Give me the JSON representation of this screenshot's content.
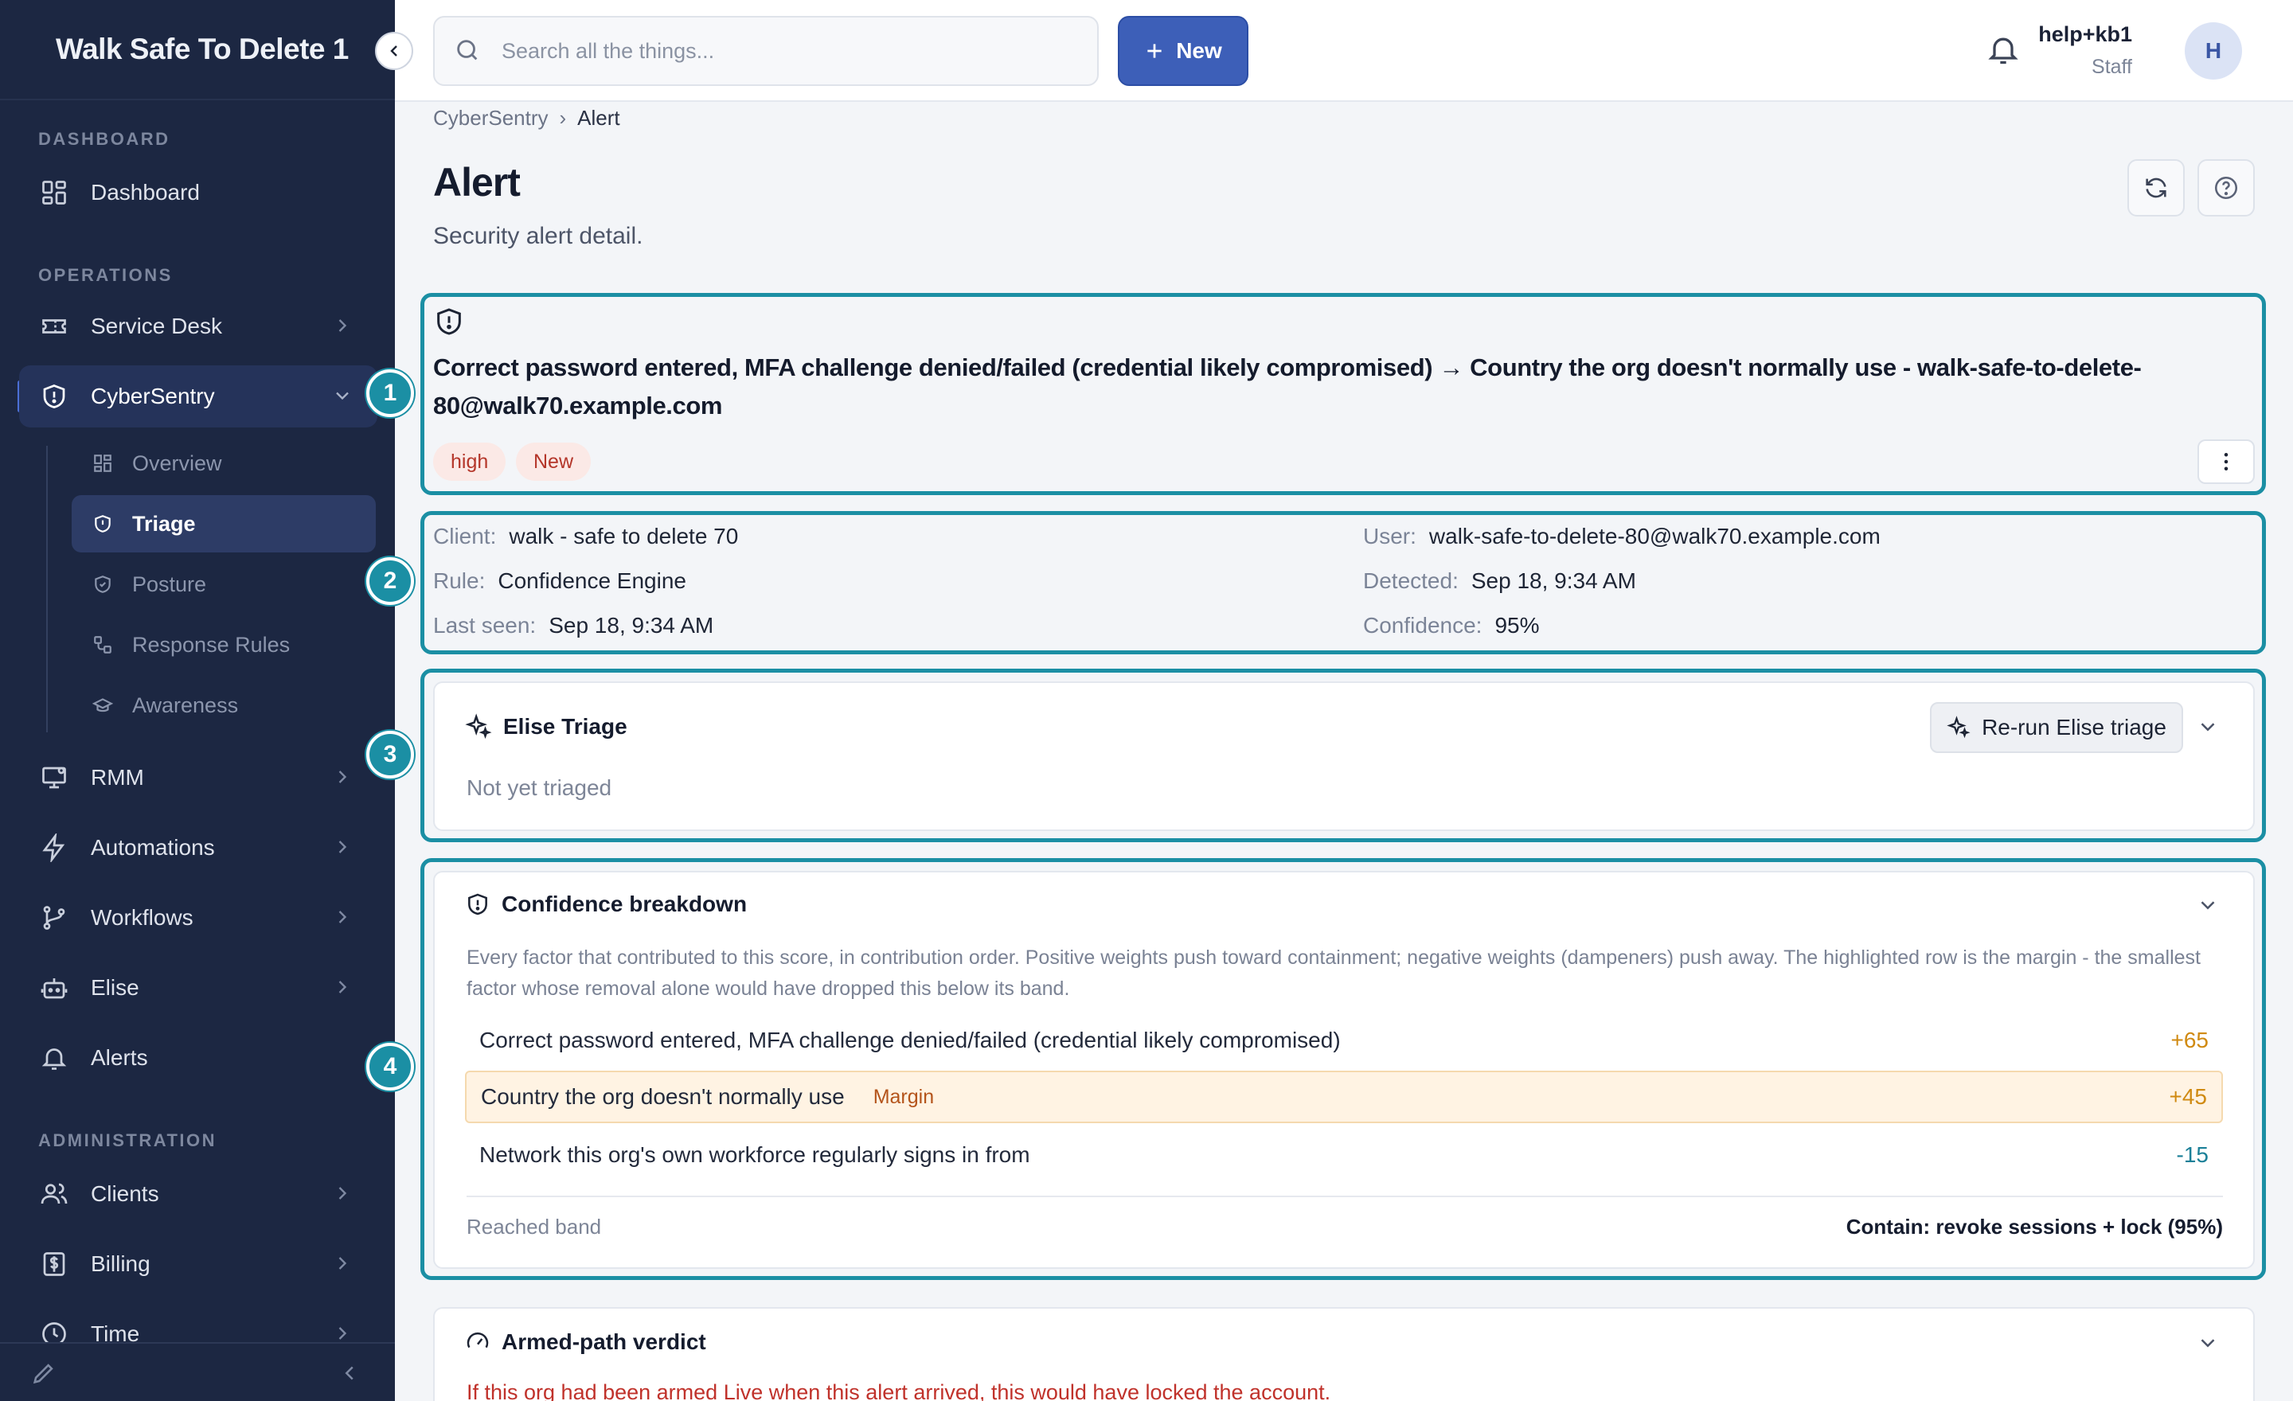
{
  "app": {
    "title": "Walk Safe To Delete 1"
  },
  "sidebar": {
    "sections": {
      "dashboard": "DASHBOARD",
      "operations": "OPERATIONS",
      "administration": "ADMINISTRATION"
    },
    "items": {
      "dashboard": "Dashboard",
      "service_desk": "Service Desk",
      "cybersentry": "CyberSentry",
      "rmm": "RMM",
      "automations": "Automations",
      "workflows": "Workflows",
      "elise": "Elise",
      "alerts": "Alerts",
      "clients": "Clients",
      "billing": "Billing",
      "time": "Time"
    },
    "subitems": {
      "overview": "Overview",
      "triage": "Triage",
      "posture": "Posture",
      "response_rules": "Response Rules",
      "awareness": "Awareness"
    },
    "active_item": "CyberSentry",
    "active_subitem": "Triage"
  },
  "topbar": {
    "search_placeholder": "Search all the things...",
    "new_label": "New",
    "user_name": "help+kb1",
    "user_role": "Staff",
    "avatar_initial": "H"
  },
  "breadcrumb": {
    "parent": "CyberSentry",
    "separator": "›",
    "current": "Alert"
  },
  "page": {
    "title": "Alert",
    "subtitle": "Security alert detail."
  },
  "alert": {
    "title": "Correct password entered, MFA challenge denied/failed (credential likely compromised) → Country the org doesn't normally use - walk-safe-to-delete-80@walk70.example.com",
    "severity": "high",
    "status": "New"
  },
  "meta": {
    "client_label": "Client:",
    "client": "walk - safe to delete 70",
    "user_label": "User:",
    "user": "walk-safe-to-delete-80@walk70.example.com",
    "rule_label": "Rule:",
    "rule": "Confidence Engine",
    "detected_label": "Detected:",
    "detected": "Sep 18, 9:34 AM",
    "last_seen_label": "Last seen:",
    "last_seen": "Sep 18, 9:34 AM",
    "confidence_label": "Confidence:",
    "confidence": "95%"
  },
  "triage": {
    "title": "Elise Triage",
    "rerun_label": "Re-run Elise triage",
    "status": "Not yet triaged"
  },
  "confidence": {
    "title": "Confidence breakdown",
    "description": "Every factor that contributed to this score, in contribution order. Positive weights push toward containment; negative weights (dampeners) push away. The highlighted row is the margin - the smallest factor whose removal alone would have dropped this below its band.",
    "factors": [
      {
        "label": "Correct password entered, MFA challenge denied/failed (credential likely compromised)",
        "weight": "+65"
      },
      {
        "label": "Country the org doesn't normally use",
        "tag": "Margin",
        "weight": "+45"
      },
      {
        "label": "Network this org's own workforce regularly signs in from",
        "weight": "-15"
      }
    ],
    "band_label": "Reached band",
    "band_value": "Contain: revoke sessions + lock (95%)"
  },
  "verdict": {
    "title": "Armed-path verdict",
    "text": "If this org had been armed Live when this alert arrived, this would have locked the account."
  },
  "markers": [
    "1",
    "2",
    "3",
    "4"
  ],
  "colors": {
    "sidebar_bg": "#1c2742",
    "accent": "#3d5fb8",
    "highlight": "#1b8fa4",
    "danger": "#c0322b",
    "positive": "#d08a12",
    "negative": "#1b8098"
  }
}
